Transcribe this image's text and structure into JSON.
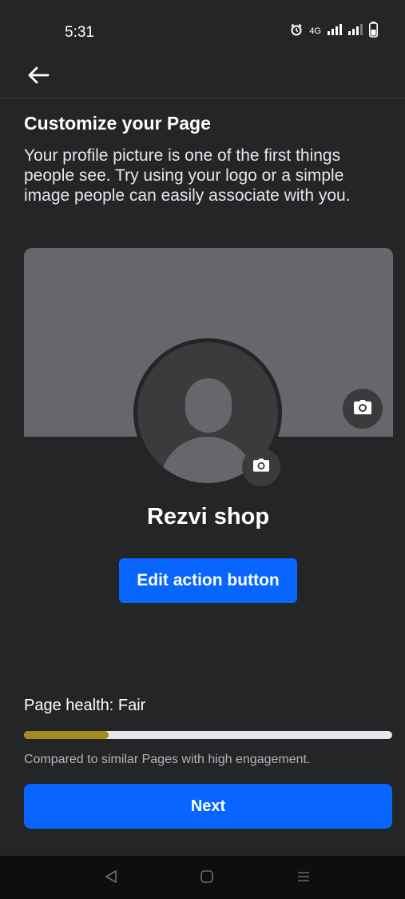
{
  "status_bar": {
    "time": "5:31",
    "network_label": "4G",
    "icons": [
      "alarm-icon",
      "signal-icon",
      "signal-icon",
      "battery-icon"
    ]
  },
  "app_bar": {
    "back_icon": "arrow-left-icon"
  },
  "main": {
    "heading": "Customize your Page",
    "description": "Your profile picture is one of the first things people see. Try using your logo or a simple image people can easily associate with you.",
    "page_name": "Rezvi shop",
    "edit_action_label": "Edit action button",
    "cover_camera_icon": "camera-icon",
    "avatar_camera_icon": "camera-icon"
  },
  "health": {
    "label": "Page health: Fair",
    "level": 0.23,
    "caption": "Compared to similar Pages with high engagement.",
    "fill_color": "#a58b1f"
  },
  "footer": {
    "next_label": "Next"
  },
  "colors": {
    "background": "#242526",
    "cover": "#65676b",
    "accent": "#0866ff"
  },
  "nav_bar": {
    "icons": [
      "back-triangle-icon",
      "home-square-icon",
      "menu-lines-icon"
    ]
  }
}
